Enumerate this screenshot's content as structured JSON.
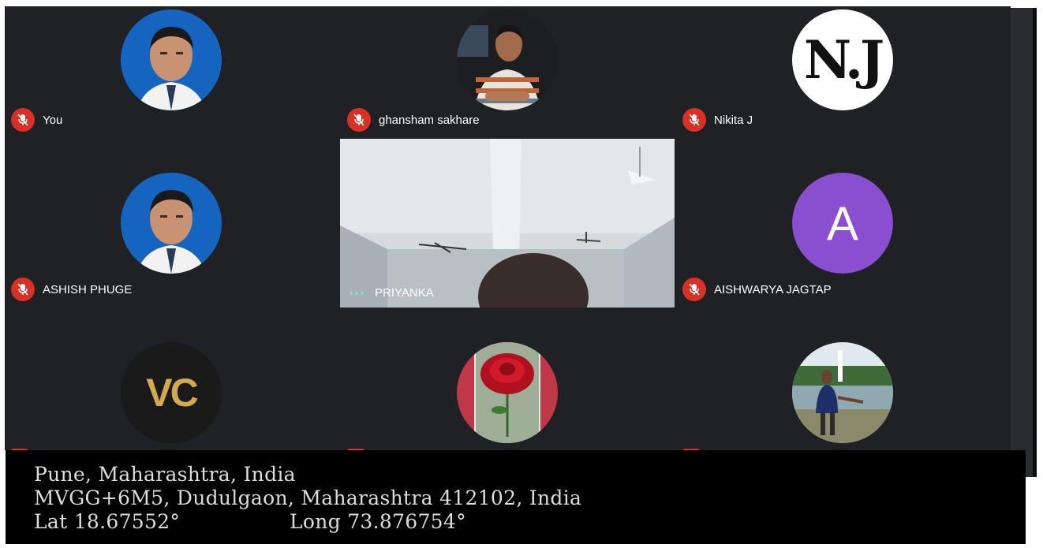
{
  "participants": [
    {
      "name": "You"
    },
    {
      "name": "ghansham sakhare"
    },
    {
      "name": "Nikita J",
      "avatar_text": "N.J"
    },
    {
      "name": "ASHISH PHUGE"
    },
    {
      "name": "PRIYANKA"
    },
    {
      "name": "AISHWARYA JAGTAP",
      "avatar_letter": "A"
    },
    {
      "avatar_text": "VC"
    }
  ],
  "colors": {
    "mute_red": "#d93025",
    "meet_background": "#202124",
    "avatar_purple": "#8a4fd1",
    "avatar_blue": "#1565c0"
  },
  "icons": {
    "muted": "mic-off-icon",
    "speaking": "audio-dots-icon"
  },
  "location_stamp": {
    "line1": "Pune, Maharashtra, India",
    "line2": "MVGG+6M5, Dudulgaon, Maharashtra 412102, India",
    "latitude": "Lat 18.67552°",
    "longitude": "Long 73.876754°"
  }
}
